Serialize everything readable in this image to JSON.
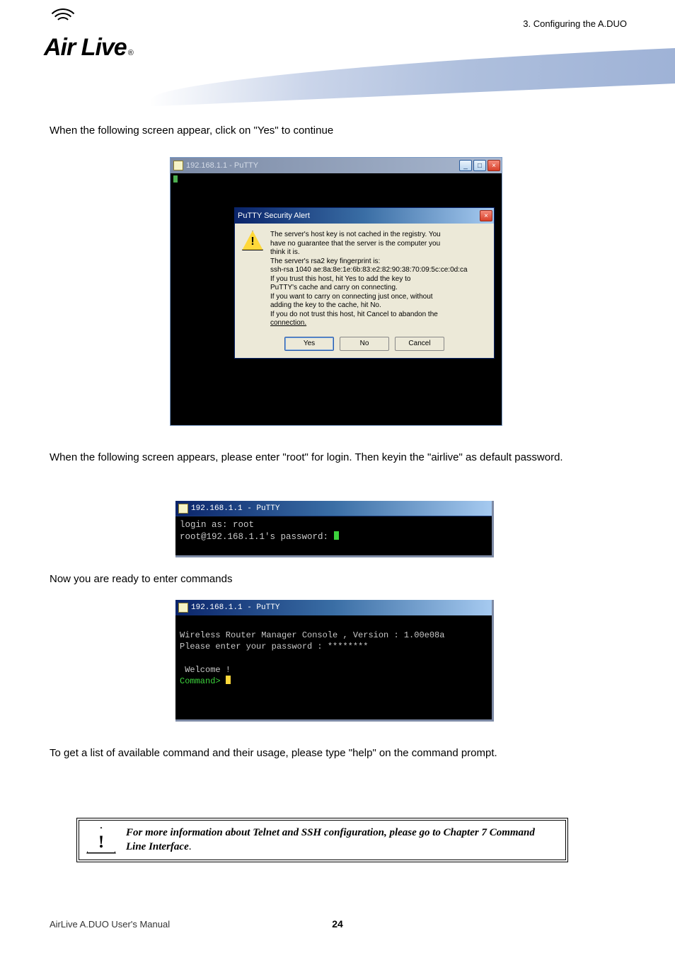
{
  "header": {
    "chapter": "3. Configuring the A.DUO"
  },
  "logo": {
    "text": "Air Live",
    "reg": "®"
  },
  "paragraphs": {
    "p1": "When the following screen appear, click on \"Yes\" to continue",
    "p2": "When the following screen appears, please enter \"root\" for login. Then keyin the \"airlive\" as default password.",
    "p3": "Now you are ready to enter commands",
    "p4": "To get a list of available command and their usage, please type \"help\" on the command prompt."
  },
  "shot1": {
    "title": "192.168.1.1 - PuTTY",
    "alert_title": "PuTTY Security Alert",
    "alert_lines": [
      "The server's host key is not cached in the registry. You",
      "have no guarantee that the server is the computer you",
      "think it is.",
      "The server's rsa2 key fingerprint is:",
      "ssh-rsa 1040 ae:8a:8e:1e:6b:83:e2:82:90:38:70:09:5c:ce:0d:ca",
      "If you trust this host, hit Yes to add the key to",
      "PuTTY's cache and carry on connecting.",
      "If you want to carry on connecting just once, without",
      "adding the key to the cache, hit No.",
      "If you do not trust this host, hit Cancel to abandon the"
    ],
    "alert_link": "connection.",
    "btn_yes": "Yes",
    "btn_no": "No",
    "btn_cancel": "Cancel"
  },
  "shot2": {
    "title": "192.168.1.1 - PuTTY",
    "line1": "login as: root",
    "line2": "root@192.168.1.1's password: "
  },
  "shot3": {
    "title": "192.168.1.1 - PuTTY",
    "line1": "Wireless Router Manager Console , Version : 1.00e08a",
    "line2": "Please enter your password : ********",
    "line3": " Welcome !",
    "prompt": "Command> "
  },
  "callout": {
    "text": "For more information about Telnet and SSH configuration, please go to Chapter 7 Command Line Interface",
    "trail": "."
  },
  "footer": {
    "left": "AirLive A.DUO User's Manual",
    "page": "24"
  }
}
